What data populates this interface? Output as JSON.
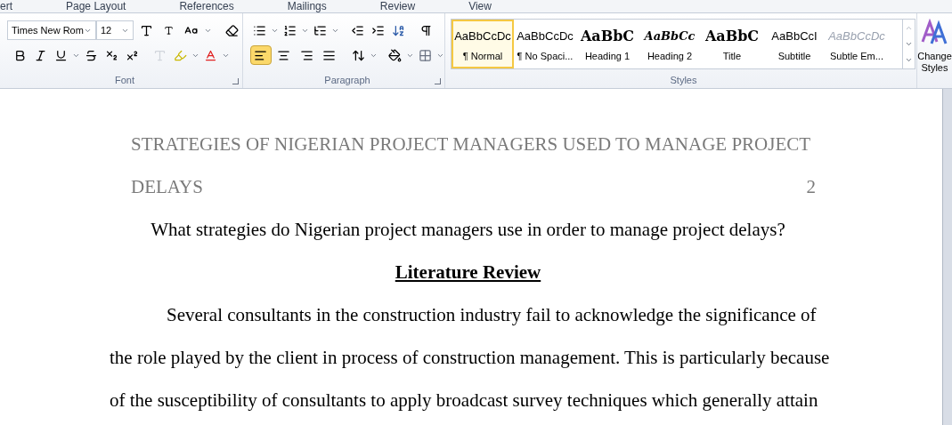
{
  "ribbon_tabs": [
    {
      "label": "ert"
    },
    {
      "label": "Page Layout"
    },
    {
      "label": "References"
    },
    {
      "label": "Mailings"
    },
    {
      "label": "Review"
    },
    {
      "label": "View"
    }
  ],
  "font_group": {
    "font_name": "Times New Rom",
    "font_size": "12",
    "label": "Font"
  },
  "paragraph_group": {
    "label": "Paragraph",
    "alignments": [
      {
        "kind": "left",
        "selected": true
      },
      {
        "kind": "center",
        "selected": false
      },
      {
        "kind": "right",
        "selected": false
      },
      {
        "kind": "justify",
        "selected": false
      }
    ]
  },
  "styles_group": {
    "label": "Styles",
    "styles": [
      {
        "preview": "AaBbCcDc",
        "name": "¶ Normal",
        "kind": "normal",
        "selected": true
      },
      {
        "preview": "AaBbCcDc",
        "name": "¶ No Spaci...",
        "kind": "normal",
        "selected": false
      },
      {
        "preview": "AaBbC",
        "name": "Heading 1",
        "kind": "heading",
        "selected": false
      },
      {
        "preview": "AaBbCc",
        "name": "Heading 2",
        "kind": "heading-italic",
        "selected": false
      },
      {
        "preview": "AaBbC",
        "name": "Title",
        "kind": "title",
        "selected": false
      },
      {
        "preview": "AaBbCcI",
        "name": "Subtitle",
        "kind": "normal",
        "selected": false
      },
      {
        "preview": "AaBbCcDc",
        "name": "Subtle Em...",
        "kind": "subtle",
        "selected": false
      }
    ]
  },
  "change_styles": {
    "label_line_1": "Change",
    "label_line_2": "Styles"
  },
  "document": {
    "header_line_1": "STRATEGIES OF NIGERIAN PROJECT MANAGERS USED TO MANAGE PROJECT",
    "header_line_2": "DELAYS",
    "page_number": "2",
    "question": "What strategies do Nigerian project managers use in order to manage project delays?",
    "heading": "Literature Review",
    "paragraph_lines": [
      "Several consultants in the construction industry fail to acknowledge the significance of",
      "the role played by the client in process of construction management. This is particularly because",
      "of the susceptibility of consultants to apply broadcast survey techniques which generally attain"
    ]
  }
}
